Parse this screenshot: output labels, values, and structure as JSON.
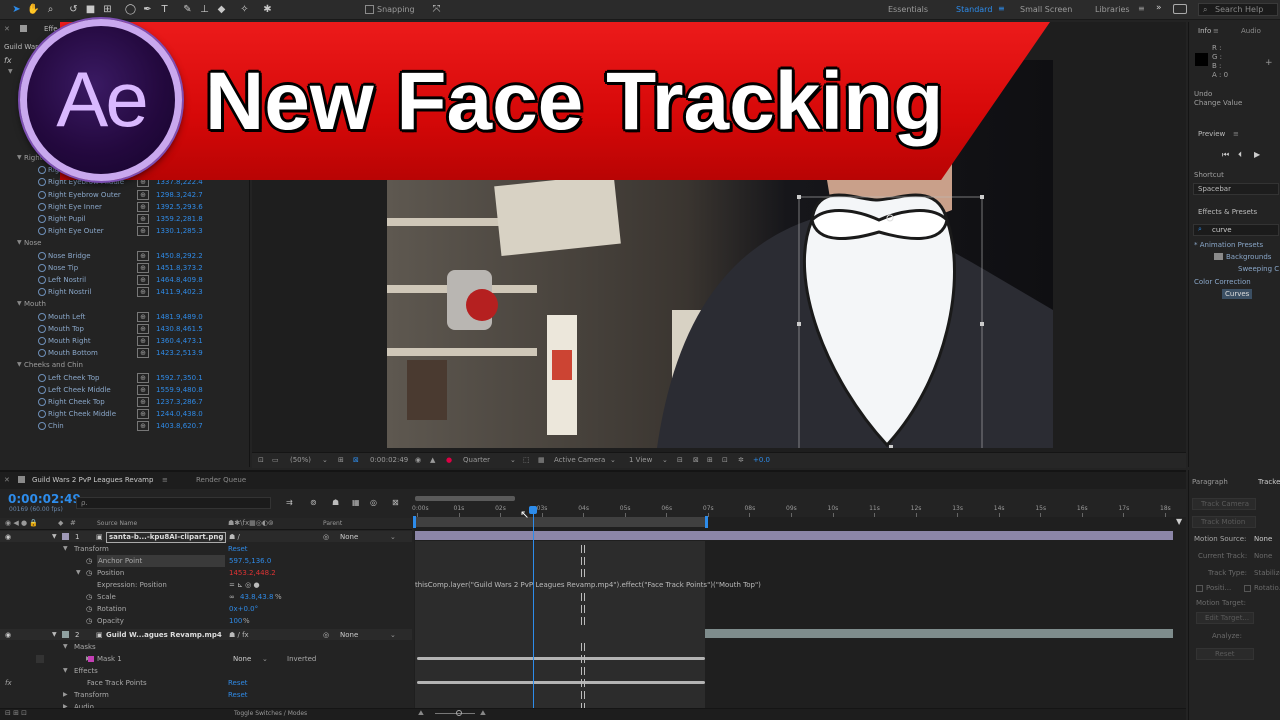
{
  "toolbar": {
    "snapping_label": "Snapping",
    "workspaces": [
      "Essentials",
      "Standard",
      "Small Screen",
      "Libraries"
    ],
    "active_workspace": "Standard",
    "search_placeholder": "Search Help"
  },
  "banner": {
    "title": "New Face Tracking",
    "logo_text": "Ae",
    "bg_color": "#e01010"
  },
  "effects_panel": {
    "tab_partial": "Effe",
    "comp_partial": "Guild Wars",
    "groups": [
      {
        "name": "Right",
        "items": [
          {
            "name": "Right",
            "value": ""
          },
          {
            "name": "Right Eyebrow Middle",
            "value": "1337.8,222.4"
          },
          {
            "name": "Right Eyebrow Outer",
            "value": "1298.3,242.7"
          },
          {
            "name": "Right Eye Inner",
            "value": "1392.5,293.6"
          },
          {
            "name": "Right Pupil",
            "value": "1359.2,281.8"
          },
          {
            "name": "Right Eye Outer",
            "value": "1330.1,285.3"
          }
        ]
      },
      {
        "name": "Nose",
        "items": [
          {
            "name": "Nose Bridge",
            "value": "1450.8,292.2"
          },
          {
            "name": "Nose Tip",
            "value": "1451.8,373.2"
          },
          {
            "name": "Left Nostril",
            "value": "1464.8,409.8"
          },
          {
            "name": "Right Nostril",
            "value": "1411.9,402.3"
          }
        ]
      },
      {
        "name": "Mouth",
        "items": [
          {
            "name": "Mouth Left",
            "value": "1481.9,489.0"
          },
          {
            "name": "Mouth Top",
            "value": "1430.8,461.5"
          },
          {
            "name": "Mouth Right",
            "value": "1360.4,473.1"
          },
          {
            "name": "Mouth Bottom",
            "value": "1423.2,513.9"
          }
        ]
      },
      {
        "name": "Cheeks and Chin",
        "items": [
          {
            "name": "Left Cheek Top",
            "value": "1592.7,350.1"
          },
          {
            "name": "Left Cheek Middle",
            "value": "1559.9,480.8"
          },
          {
            "name": "Right Cheek Top",
            "value": "1237.3,286.7"
          },
          {
            "name": "Right Cheek Middle",
            "value": "1244.0,438.0"
          },
          {
            "name": "Chin",
            "value": "1403.8,620.7"
          }
        ]
      }
    ]
  },
  "viewer_bar": {
    "zoom": "(50%)",
    "timecode": "0:00:02:49",
    "resolution": "Quarter",
    "camera": "Active Camera",
    "view": "1 View",
    "exposure": "+0.0"
  },
  "info_panel": {
    "tabs": [
      "Info",
      "Audio"
    ],
    "channels": [
      "R :",
      "G :",
      "B :",
      "A : 0"
    ],
    "undo": "Undo",
    "change_value": "Change Value"
  },
  "preview_panel": {
    "title": "Preview",
    "shortcut_label": "Shortcut",
    "shortcut_value": "Spacebar"
  },
  "effects_presets": {
    "title": "Effects & Presets",
    "search_value": "curve",
    "tree": [
      "* Animation Presets",
      "Backgrounds",
      "Sweeping C",
      "Color Correction",
      "Curves"
    ]
  },
  "timeline": {
    "tabs": [
      "Guild Wars 2 PvP Leagues Revamp",
      "Render Queue"
    ],
    "timecode": "0:00:02:49",
    "frame_info": "00169 (60.00 fps)",
    "search_placeholder": "ρ.",
    "col_source": "Source Name",
    "col_parent": "Parent",
    "layers": [
      {
        "num": "1",
        "name": "santa-b...-kpu8AI-clipart.png",
        "parent": "None"
      },
      {
        "num": "2",
        "name": "Guild W...agues Revamp.mp4",
        "parent": "None"
      }
    ],
    "props": {
      "transform": "Transform",
      "reset": "Reset",
      "anchor_point": "Anchor Point",
      "anchor_value": "597.5,136.0",
      "position": "Position",
      "position_value": "1453.2,448.2",
      "expression_label": "Expression: Position",
      "expression_text": "thisComp.layer(\"Guild Wars 2 PvP Leagues Revamp.mp4\").effect(\"Face Track Points\")(\"Mouth Top\")",
      "scale": "Scale",
      "scale_value": "43.8,43.8",
      "scale_unit": "%",
      "rotation": "Rotation",
      "rotation_value": "0x+0.0°",
      "opacity": "Opacity",
      "opacity_value": "100",
      "opacity_unit": "%",
      "masks": "Masks",
      "mask1": "Mask 1",
      "mask_mode": "None",
      "inverted": "Inverted",
      "effects": "Effects",
      "face_track": "Face Track Points",
      "transform2": "Transform",
      "audio": "Audio",
      "toggle": "Toggle Switches / Modes"
    },
    "ticks": [
      "0:00s",
      "01s",
      "02s",
      "03s",
      "04s",
      "05s",
      "06s",
      "07s",
      "08s",
      "09s",
      "10s",
      "11s",
      "12s",
      "13s",
      "14s",
      "15s",
      "16s",
      "17s",
      "18s"
    ],
    "playhead_fraction": 0.155
  },
  "tracker_panel": {
    "tabs": [
      "Paragraph",
      "Tracker"
    ],
    "track_camera": "Track Camera",
    "track_motion": "Track Motion",
    "motion_source_label": "Motion Source:",
    "motion_source_value": "None",
    "current_track": "Current Track:",
    "current_track_value": "None",
    "track_type": "Track Type:",
    "track_type_value": "Stabilize",
    "position_opt": "Positi...",
    "rotation_opt": "Rotatio...",
    "motion_target": "Motion Target:",
    "edit_target": "Edit Target...",
    "analyze": "Analyze:",
    "reset": "Reset"
  }
}
